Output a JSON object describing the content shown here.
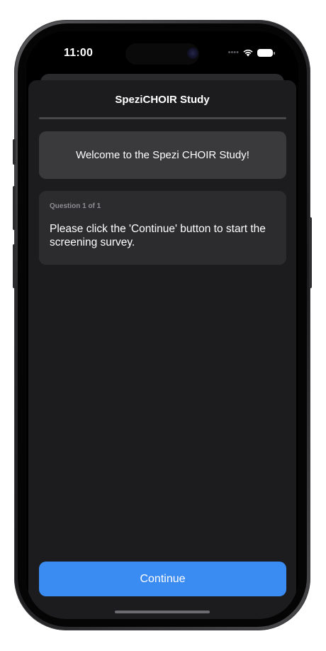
{
  "status_bar": {
    "time": "11:00",
    "icons": [
      "signal-dots-icon",
      "wifi-icon",
      "battery-icon"
    ]
  },
  "nav": {
    "title": "SpeziCHOIR Study"
  },
  "welcome": {
    "text": "Welcome to the Spezi CHOIR Study!"
  },
  "question": {
    "counter": "Question 1 of 1",
    "text": "Please click the 'Continue' button to start the screening survey."
  },
  "actions": {
    "continue_label": "Continue"
  },
  "colors": {
    "accent": "#3a8bf2",
    "background": "#1c1c1e",
    "card": "#2c2c2e",
    "card_highlight": "#3a3a3c"
  }
}
